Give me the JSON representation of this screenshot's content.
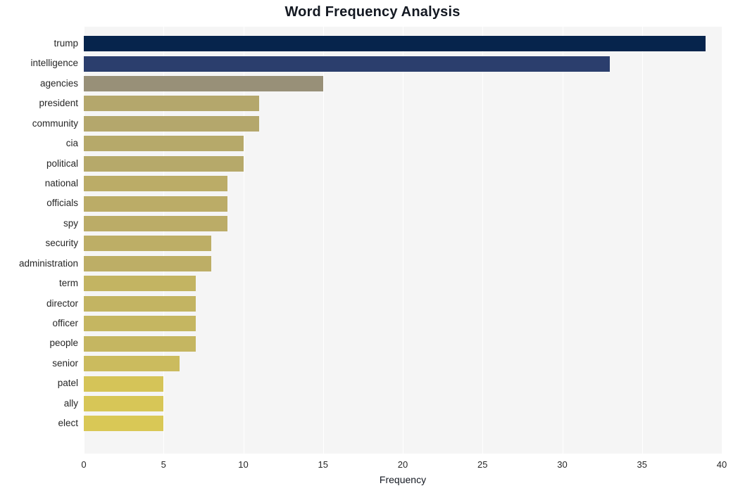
{
  "chart_data": {
    "type": "bar",
    "orientation": "horizontal",
    "title": "Word Frequency Analysis",
    "xlabel": "Frequency",
    "ylabel": "",
    "xlim": [
      0,
      40
    ],
    "x_ticks": [
      0,
      5,
      10,
      15,
      20,
      25,
      30,
      35,
      40
    ],
    "grid": "vertical-only",
    "legend": "none",
    "categories": [
      "trump",
      "intelligence",
      "agencies",
      "president",
      "community",
      "cia",
      "political",
      "national",
      "officials",
      "spy",
      "security",
      "administration",
      "term",
      "director",
      "officer",
      "people",
      "senior",
      "patel",
      "ally",
      "elect"
    ],
    "values": [
      39,
      33,
      15,
      11,
      11,
      10,
      10,
      9,
      9,
      9,
      8,
      8,
      7,
      7,
      7,
      7,
      6,
      5,
      5,
      5
    ],
    "bar_colors": [
      "#06244c",
      "#2b3e6d",
      "#989078",
      "#b4a76c",
      "#b4a76c",
      "#b6a96a",
      "#b6a96a",
      "#bbac67",
      "#bbac67",
      "#bbac67",
      "#bdae66",
      "#bdae66",
      "#c3b462",
      "#c3b462",
      "#c5b661",
      "#c5b661",
      "#cbbb5e",
      "#d5c458",
      "#d7c657",
      "#d9c856"
    ]
  },
  "style": {
    "plot_background": "#f5f5f5",
    "gridline_color": "#ffffff",
    "figure_background": "#ffffff",
    "title_color": "#131821",
    "tick_label_color": "#262626"
  }
}
